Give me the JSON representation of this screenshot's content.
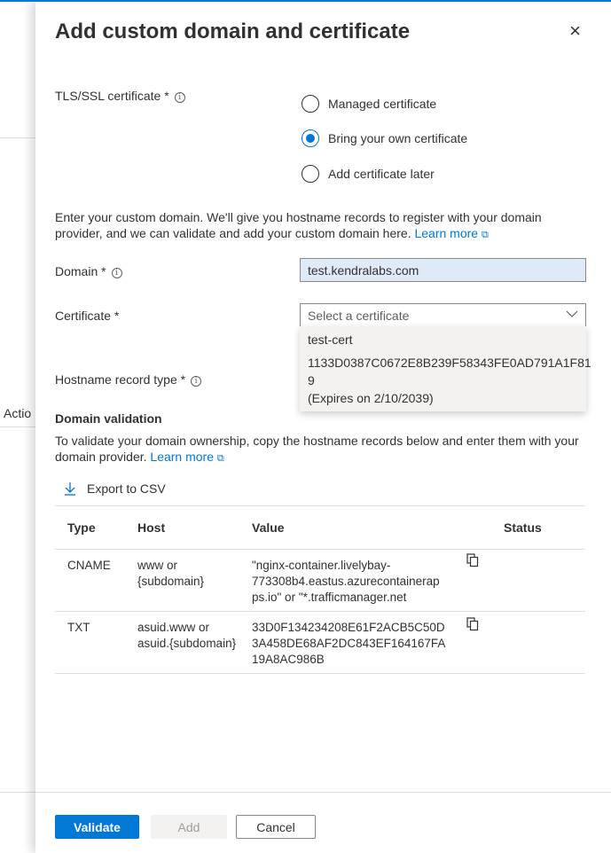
{
  "background": {
    "partial_label": "Actio"
  },
  "panel": {
    "title": "Add custom domain and certificate",
    "close_glyph": "×"
  },
  "tls": {
    "label": "TLS/SSL certificate *",
    "options": [
      "Managed certificate",
      "Bring your own certificate",
      "Add certificate later"
    ],
    "selected_index": 1
  },
  "description": {
    "text": "Enter your custom domain. We'll give you hostname records to register with your domain provider, and we can validate and add your custom domain here.",
    "learn_more": "Learn more"
  },
  "domain": {
    "label": "Domain *",
    "value": "test.kendralabs.com"
  },
  "certificate": {
    "label": "Certificate *",
    "placeholder": "Select a certificate",
    "dropdown": {
      "name": "test-cert",
      "thumbprint_line1": "1133D0387C0672E8B239F58343FE0AD791A1F81",
      "thumbprint_line2": "9",
      "expiry": "(Expires on 2/10/2039)"
    }
  },
  "hostname_record": {
    "label": "Hostname record type *"
  },
  "validation": {
    "title": "Domain validation",
    "description": "To validate your domain ownership, copy the hostname records below and enter them with your domain provider.",
    "learn_more": "Learn more",
    "export_label": "Export to CSV",
    "columns": [
      "Type",
      "Host",
      "Value",
      "Status"
    ],
    "rows": [
      {
        "type": "CNAME",
        "host_lines": [
          "www or",
          "{subdomain}"
        ],
        "value_lines": [
          "\"nginx-container.livelybay-",
          "773308b4.eastus.azurecontainerap",
          "ps.io\" or \"*.trafficmanager.net"
        ],
        "status": ""
      },
      {
        "type": "TXT",
        "host_lines": [
          "asuid.www or",
          "asuid.{subdomain}"
        ],
        "value_lines": [
          "33D0F134234208E61F2ACB5C50D",
          "3A458DE68AF2DC843EF164167FA",
          "19A8AC986B"
        ],
        "status": ""
      }
    ]
  },
  "footer": {
    "validate": "Validate",
    "add": "Add",
    "cancel": "Cancel"
  },
  "colors": {
    "accent": "#0078d4",
    "text": "#323130",
    "input_fill": "#dfeaf8"
  }
}
